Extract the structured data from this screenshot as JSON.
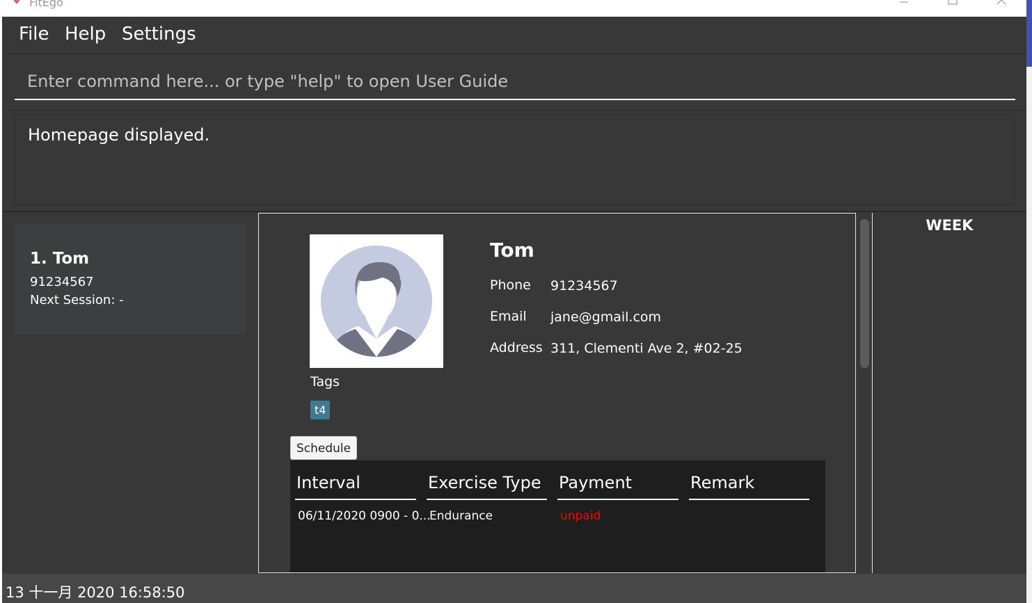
{
  "window": {
    "title": "FitEgo"
  },
  "menu": {
    "items": [
      "File",
      "Help",
      "Settings"
    ]
  },
  "command": {
    "placeholder": "Enter command here... or type \"help\" to open User Guide",
    "value": ""
  },
  "result": {
    "message": "Homepage displayed."
  },
  "client_list": {
    "items": [
      {
        "index_name": "1.  Tom",
        "phone": "91234567",
        "next_session": "Next Session:  -"
      }
    ]
  },
  "client_detail": {
    "name": "Tom",
    "phone_label": "Phone",
    "phone": "91234567",
    "email_label": "Email",
    "email": "jane@gmail.com",
    "address_label": "Address",
    "address": "311, Clementi Ave 2, #02-25",
    "tags_label": "Tags",
    "tags": [
      "t4"
    ],
    "schedule_tab": "Schedule",
    "schedule": {
      "columns": [
        "Interval",
        "Exercise Type",
        "Payment",
        "Remark"
      ],
      "rows": [
        {
          "interval": "06/11/2020 0900 - 0...",
          "exercise_type": "Endurance",
          "payment": "unpaid",
          "remark": ""
        }
      ]
    }
  },
  "calendar": {
    "label": "WEEK"
  },
  "status": {
    "datetime": "13 十一月 2020 16:58:50"
  },
  "colors": {
    "background": "#383838",
    "tag": "#3e7b91",
    "unpaid": "#ff0000",
    "status_bar": "#474747"
  }
}
